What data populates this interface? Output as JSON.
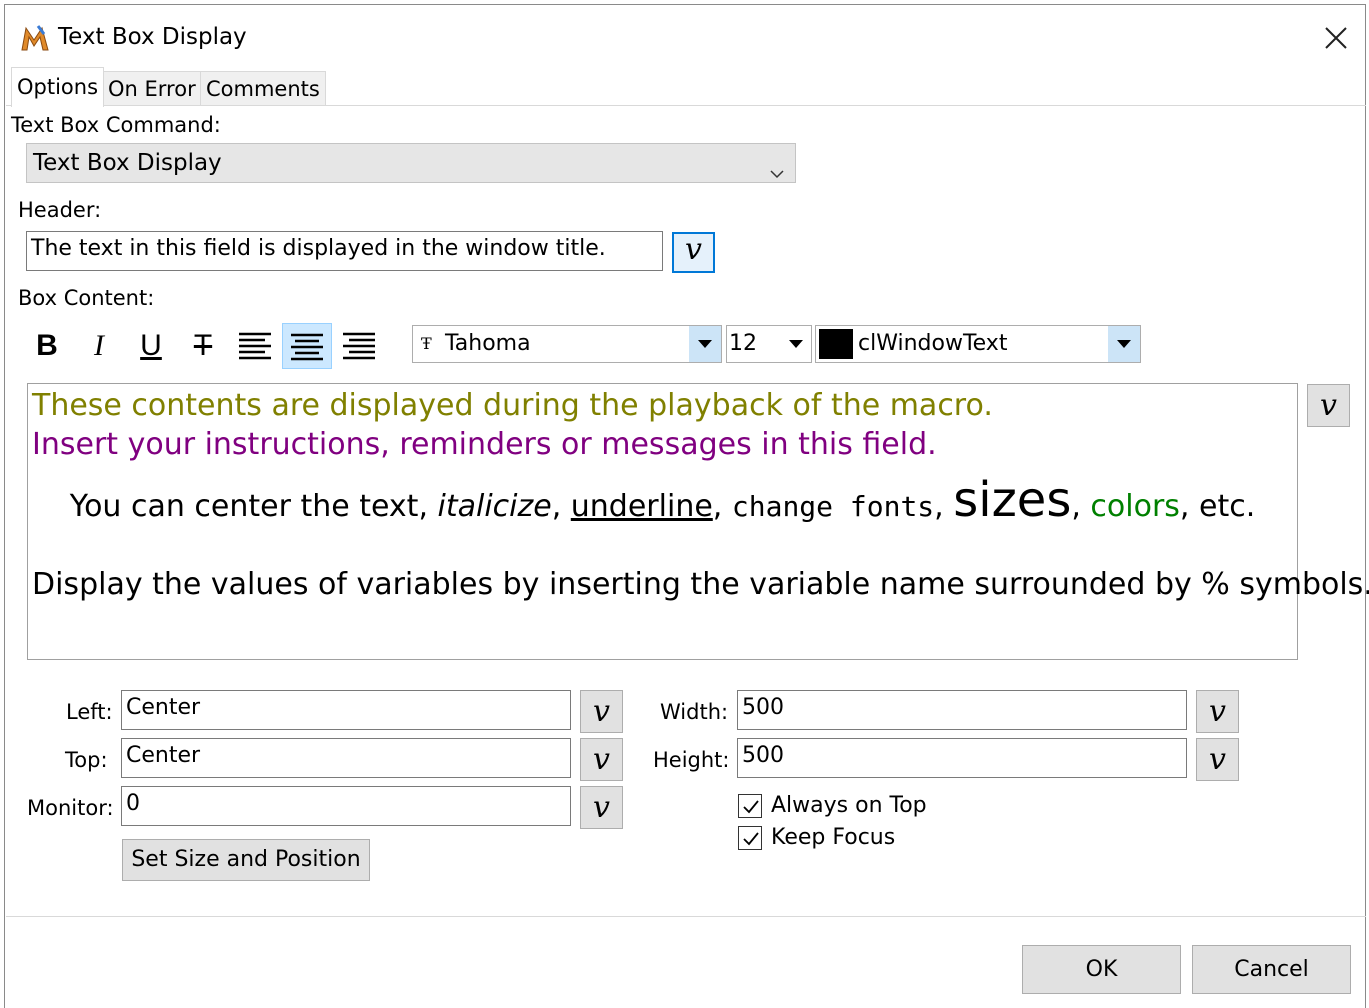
{
  "window": {
    "title": "Text Box Display"
  },
  "tabs": [
    {
      "label": "Options"
    },
    {
      "label": "On Error"
    },
    {
      "label": "Comments"
    }
  ],
  "command": {
    "label": "Text Box Command:",
    "value": "Text Box Display"
  },
  "header": {
    "label": "Header:",
    "value": "The text in this field is displayed in the window title."
  },
  "content": {
    "label": "Box Content:",
    "font": "Tahoma",
    "size": "12",
    "color_name": "clWindowText",
    "line1": "These contents are displayed during the playback of the macro.",
    "line2": "Insert your instructions, reminders or messages in this field.",
    "line3": {
      "p1": "You can center the text, ",
      "italic": "italicize",
      "p2": ", ",
      "underline": "underline",
      "p3": ", ",
      "fonts": "change fonts",
      "p4": ", ",
      "sizes": "sizes",
      "p5": ", ",
      "colors": "colors",
      "p6": ", etc."
    },
    "line4": "Display the values of variables by inserting the variable name surrounded by % symbols.",
    "colors": {
      "line1": "#808000",
      "line2": "#800080",
      "colors_word": "#008000"
    }
  },
  "toolbar": {
    "bold": "B",
    "italic": "I",
    "underline": "U",
    "strike": "T"
  },
  "position": {
    "left_label": "Left:",
    "left_value": "Center",
    "top_label": "Top:",
    "top_value": "Center",
    "monitor_label": "Monitor:",
    "monitor_value": "0",
    "width_label": "Width:",
    "width_value": "500",
    "height_label": "Height:",
    "height_value": "500",
    "set_button": "Set Size and Position"
  },
  "options": {
    "always_on_top": "Always on Top",
    "keep_focus": "Keep Focus"
  },
  "variable_button": "v",
  "buttons": {
    "ok": "OK",
    "cancel": "Cancel"
  }
}
